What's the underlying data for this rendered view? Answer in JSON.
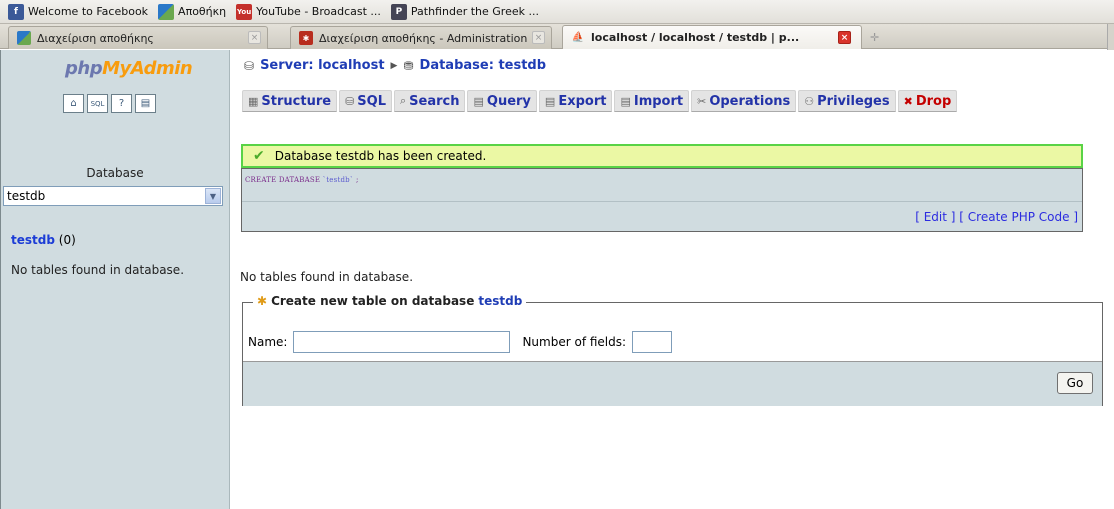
{
  "bookmarks": [
    {
      "label": "Welcome to Facebook",
      "icon": "facebook-icon",
      "color": "#3b5998",
      "glyph": "f"
    },
    {
      "label": "Αποθήκη",
      "icon": "joomla-icon",
      "color": "#6aa84f",
      "glyph": ""
    },
    {
      "label": "YouTube - Broadcast ...",
      "icon": "youtube-icon",
      "color": "#c4302b",
      "glyph": "You"
    },
    {
      "label": "Pathfinder the Greek ...",
      "icon": "pathfinder-icon",
      "color": "#445",
      "glyph": "P"
    }
  ],
  "tabs": [
    {
      "label": "Διαχείριση αποθήκης",
      "active": false
    },
    {
      "label": "Διαχείριση αποθήκης - Administration",
      "active": false
    },
    {
      "label": "localhost / localhost / testdb | p...",
      "active": true
    }
  ],
  "sidebar": {
    "logo_part1": "php",
    "logo_part2": "MyAdmin",
    "database_label": "Database",
    "selected_database": "testdb",
    "db_name": "testdb",
    "db_count": "(0)",
    "no_tables": "No tables found in database."
  },
  "main": {
    "server_label": "Server: localhost",
    "database_label": "Database: testdb",
    "tabs": [
      {
        "label": "Structure",
        "icon": "structure-icon",
        "glyph": "▦"
      },
      {
        "label": "SQL",
        "icon": "sql-icon",
        "glyph": "⛁"
      },
      {
        "label": "Search",
        "icon": "search-icon",
        "glyph": "⌕"
      },
      {
        "label": "Query",
        "icon": "query-icon",
        "glyph": "▤"
      },
      {
        "label": "Export",
        "icon": "export-icon",
        "glyph": "▤"
      },
      {
        "label": "Import",
        "icon": "import-icon",
        "glyph": "▤"
      },
      {
        "label": "Operations",
        "icon": "operations-icon",
        "glyph": "✂"
      },
      {
        "label": "Privileges",
        "icon": "privileges-icon",
        "glyph": "⚇"
      },
      {
        "label": "Drop",
        "icon": "drop-icon",
        "glyph": "✖"
      }
    ],
    "notice": "Database testdb has been created.",
    "sql_keyword": "CREATE DATABASE",
    "sql_name": "`testdb`",
    "sql_end": ";",
    "edit_link": "Edit",
    "create_php_link": "Create PHP Code",
    "no_tables": "No tables found in database.",
    "create_table_legend": "Create new table on database",
    "create_table_db": "testdb",
    "name_label": "Name:",
    "fields_label": "Number of fields:",
    "name_value": "",
    "fields_value": "",
    "go_label": "Go"
  },
  "colors": {
    "sidebar_bg": "#d0dce0",
    "notice_bg": "#ebf8a4",
    "notice_border": "#59d346",
    "link_blue": "#1f3db5",
    "drop_red": "#c40000"
  }
}
